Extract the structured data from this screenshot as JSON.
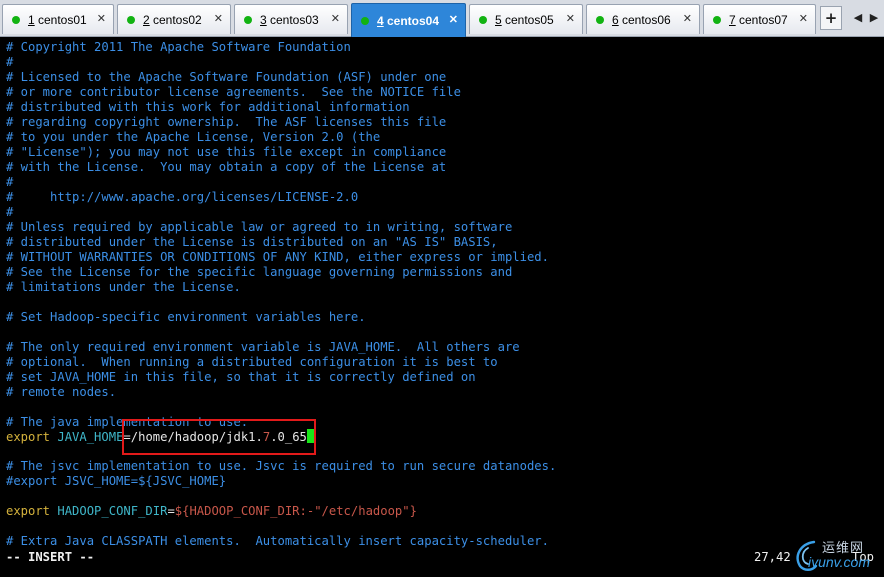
{
  "tabs": [
    {
      "num": "1",
      "label": " centos01",
      "close": "✕",
      "active": false
    },
    {
      "num": "2",
      "label": " centos02",
      "close": "✕",
      "active": false
    },
    {
      "num": "3",
      "label": " centos03",
      "close": "✕",
      "active": false
    },
    {
      "num": "4",
      "label": " centos04",
      "close": "✕",
      "active": true
    },
    {
      "num": "5",
      "label": " centos05",
      "close": "✕",
      "active": false
    },
    {
      "num": "6",
      "label": " centos06",
      "close": "✕",
      "active": false
    },
    {
      "num": "7",
      "label": " centos07",
      "close": "✕",
      "active": false
    }
  ],
  "tabbar": {
    "plus": "+",
    "prev": "◀",
    "next": "▶"
  },
  "editor": {
    "lines": [
      "# Copyright 2011 The Apache Software Foundation",
      "#",
      "# Licensed to the Apache Software Foundation (ASF) under one",
      "# or more contributor license agreements.  See the NOTICE file",
      "# distributed with this work for additional information",
      "# regarding copyright ownership.  The ASF licenses this file",
      "# to you under the Apache License, Version 2.0 (the",
      "# \"License\"); you may not use this file except in compliance",
      "# with the License.  You may obtain a copy of the License at",
      "#",
      "#     http://www.apache.org/licenses/LICENSE-2.0",
      "#",
      "# Unless required by applicable law or agreed to in writing, software",
      "# distributed under the License is distributed on an \"AS IS\" BASIS,",
      "# WITHOUT WARRANTIES OR CONDITIONS OF ANY KIND, either express or implied.",
      "# See the License for the specific language governing permissions and",
      "# limitations under the License.",
      "",
      "# Set Hadoop-specific environment variables here.",
      "",
      "# The only required environment variable is JAVA_HOME.  All others are",
      "# optional.  When running a distributed configuration it is best to",
      "# set JAVA_HOME in this file, so that it is correctly defined on",
      "# remote nodes.",
      "",
      "# The java implementation to use."
    ],
    "java_export": {
      "kw": "export ",
      "var": "JAVA_HOME",
      "eq": "=",
      "path_a": "/home/hadoop/jdk1.",
      "path_7": "7",
      "path_b": ".0_65"
    },
    "line_blank2": "",
    "jsvc_comment": "# The jsvc implementation to use. Jsvc is required to run secure datanodes.",
    "jsvc_export": "#export JSVC_HOME=${JSVC_HOME}",
    "line_blank3": "",
    "conf_export": {
      "kw": "export ",
      "var": "HADOOP_CONF_DIR",
      "eq": "=",
      "ref": "${HADOOP_CONF_DIR:-",
      "str": "\"/etc/hadoop\"",
      "close": "}"
    },
    "line_blank4": "",
    "classpath_comment": "# Extra Java CLASSPATH elements.  Automatically insert capacity-scheduler."
  },
  "status": {
    "mode": "-- INSERT --",
    "position": "27,42",
    "scroll": "Top"
  },
  "watermark": {
    "cn": "运维网",
    "url": "iyunv.com"
  }
}
